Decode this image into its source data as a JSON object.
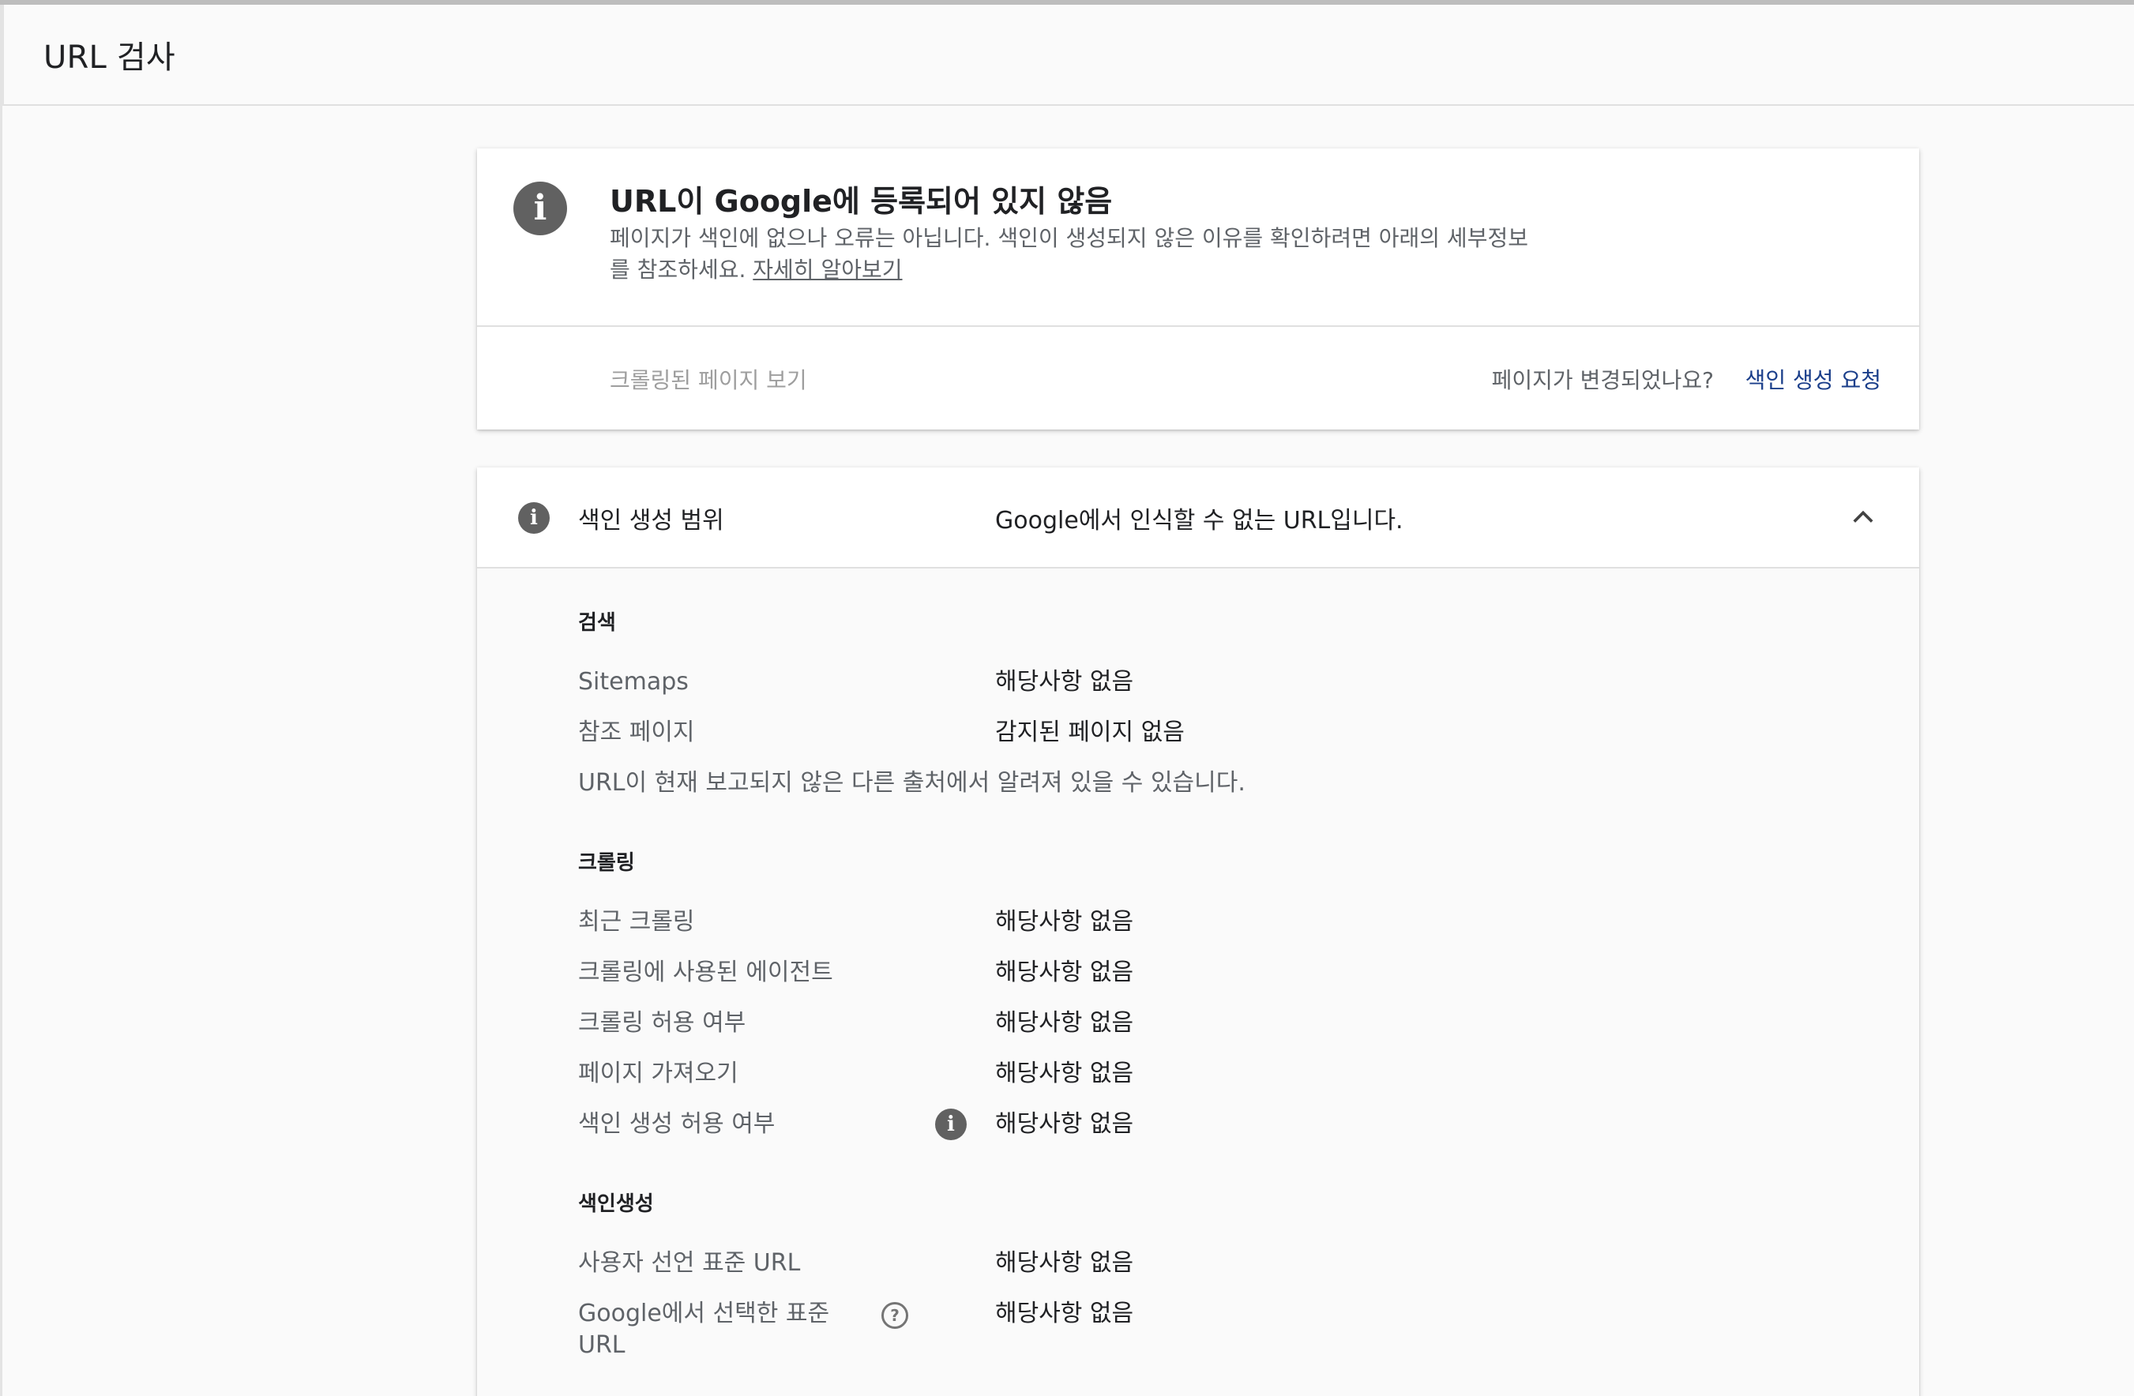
{
  "header": {
    "title": "URL 검사"
  },
  "status_card": {
    "title": "URL이 Google에 등록되어 있지 않음",
    "description": "페이지가 색인에 없으나 오류는 아닙니다. 색인이 생성되지 않은 이유를 확인하려면 아래의 세부정보를 참조하세요.",
    "learn_more": "자세히 알아보기",
    "view_crawled": "크롤링된 페이지 보기",
    "changed_question": "페이지가 변경되었나요?",
    "request_indexing": "색인 생성 요청"
  },
  "coverage": {
    "label": "색인 생성 범위",
    "value": "Google에서 인식할 수 없는 URL입니다.",
    "discovery": {
      "heading": "검색",
      "rows": [
        {
          "label": "Sitemaps",
          "value": "해당사항 없음"
        },
        {
          "label": "참조 페이지",
          "value": "감지된 페이지 없음"
        }
      ],
      "note": "URL이 현재 보고되지 않은 다른 출처에서 알려져 있을 수 있습니다."
    },
    "crawl": {
      "heading": "크롤링",
      "rows": [
        {
          "label": "최근 크롤링",
          "value": "해당사항 없음"
        },
        {
          "label": "크롤링에 사용된 에이전트",
          "value": "해당사항 없음"
        },
        {
          "label": "크롤링 허용 여부",
          "value": "해당사항 없음"
        },
        {
          "label": "페이지 가져오기",
          "value": "해당사항 없음"
        },
        {
          "label": "색인 생성 허용 여부",
          "value": "해당사항 없음"
        }
      ]
    },
    "indexing": {
      "heading": "색인생성",
      "rows": [
        {
          "label": "사용자 선언 표준 URL",
          "value": "해당사항 없음"
        },
        {
          "label": "Google에서 선택한 표준 URL",
          "value": "해당사항 없음"
        }
      ]
    }
  },
  "icons": {
    "status": "info-icon",
    "coverage": "info-icon",
    "indexing_allowed_info": "info-icon",
    "google_canonical_help": "help-icon",
    "collapse": "chevron-up-icon"
  },
  "colors": {
    "link": "#1a3e8a",
    "icon": "#616161",
    "muted_text": "#5f6368",
    "disabled_text": "#9e9e9e"
  }
}
